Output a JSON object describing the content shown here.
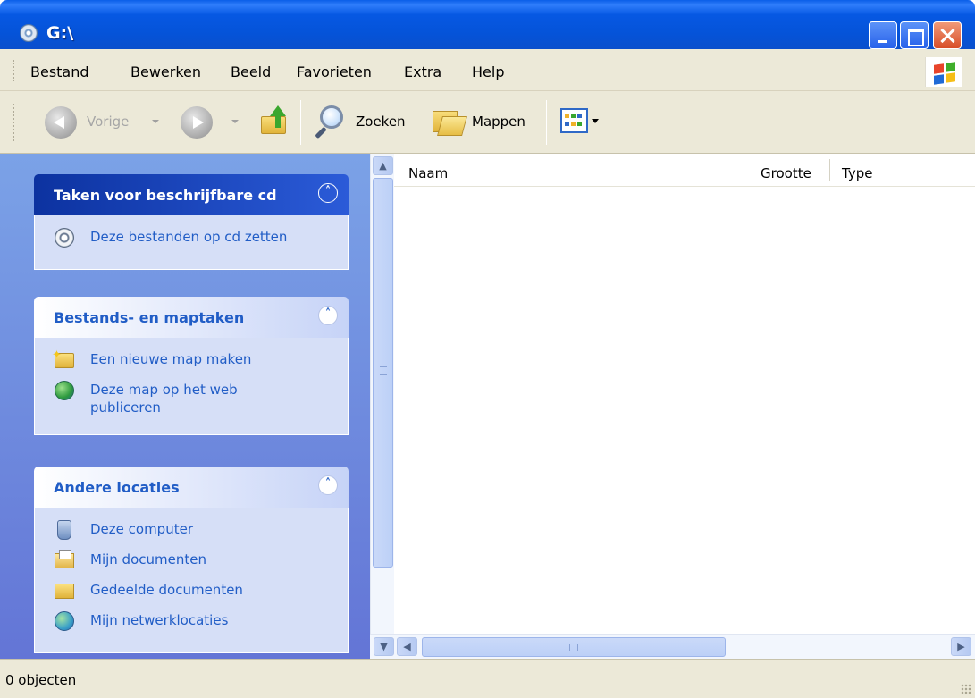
{
  "window": {
    "title": "G:\\"
  },
  "menu": {
    "items": [
      {
        "label": "Bestand"
      },
      {
        "label": "Bewerken"
      },
      {
        "label": "Beeld"
      },
      {
        "label": "Favorieten"
      },
      {
        "label": "Extra"
      },
      {
        "label": "Help"
      }
    ]
  },
  "toolbar": {
    "back_label": "Vorige",
    "search_label": "Zoeken",
    "folders_label": "Mappen"
  },
  "taskpane": {
    "panels": [
      {
        "title": "Taken voor beschrijfbare cd",
        "tasks": [
          {
            "label": "Deze bestanden op cd zetten",
            "icon": "cd-icon"
          }
        ]
      },
      {
        "title": "Bestands- en maptaken",
        "tasks": [
          {
            "label": "Een nieuwe map maken",
            "icon": "new-folder-icon"
          },
          {
            "label": "Deze map op het web publiceren",
            "icon": "publish-web-icon"
          }
        ]
      },
      {
        "title": "Andere locaties",
        "tasks": [
          {
            "label": "Deze computer",
            "icon": "computer-icon"
          },
          {
            "label": "Mijn documenten",
            "icon": "my-documents-icon"
          },
          {
            "label": "Gedeelde documenten",
            "icon": "shared-documents-icon"
          },
          {
            "label": "Mijn netwerklocaties",
            "icon": "network-places-icon"
          }
        ]
      }
    ]
  },
  "list": {
    "columns": [
      {
        "label": "Naam"
      },
      {
        "label": "Grootte"
      },
      {
        "label": "Type"
      }
    ],
    "rows": []
  },
  "statusbar": {
    "text": "0 objecten"
  },
  "colors": {
    "title_bar": "#0553d8",
    "task_link": "#215dc6",
    "chrome": "#ece9d8"
  }
}
